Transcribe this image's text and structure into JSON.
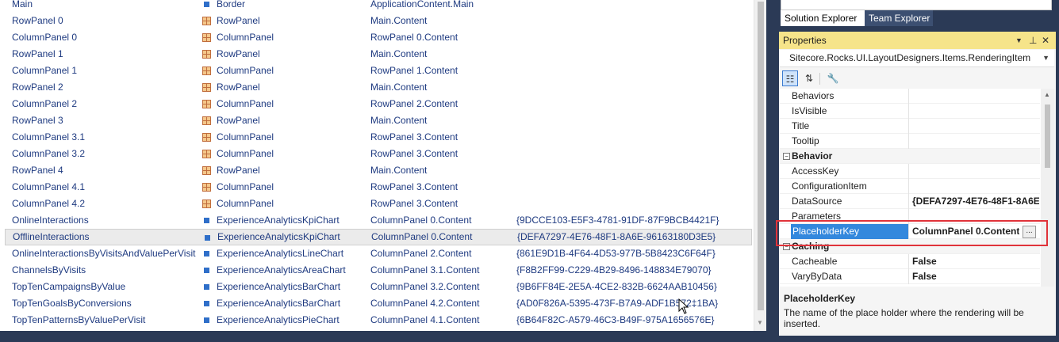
{
  "layout_list": {
    "rows": [
      {
        "name": "Main",
        "icon": "border-icon",
        "type": "Border",
        "placeholder": "ApplicationContent.Main",
        "datasource": ""
      },
      {
        "name": "RowPanel 0",
        "icon": "panel-grid-icon",
        "type": "RowPanel",
        "placeholder": "Main.Content",
        "datasource": ""
      },
      {
        "name": "ColumnPanel 0",
        "icon": "panel-grid-icon",
        "type": "ColumnPanel",
        "placeholder": "RowPanel 0.Content",
        "datasource": ""
      },
      {
        "name": "RowPanel 1",
        "icon": "panel-grid-icon",
        "type": "RowPanel",
        "placeholder": "Main.Content",
        "datasource": ""
      },
      {
        "name": "ColumnPanel 1",
        "icon": "panel-grid-icon",
        "type": "ColumnPanel",
        "placeholder": "RowPanel 1.Content",
        "datasource": ""
      },
      {
        "name": "RowPanel 2",
        "icon": "panel-grid-icon",
        "type": "RowPanel",
        "placeholder": "Main.Content",
        "datasource": ""
      },
      {
        "name": "ColumnPanel 2",
        "icon": "panel-grid-icon",
        "type": "ColumnPanel",
        "placeholder": "RowPanel 2.Content",
        "datasource": ""
      },
      {
        "name": "RowPanel 3",
        "icon": "panel-grid-icon",
        "type": "RowPanel",
        "placeholder": "Main.Content",
        "datasource": ""
      },
      {
        "name": "ColumnPanel 3.1",
        "icon": "panel-grid-icon",
        "type": "ColumnPanel",
        "placeholder": "RowPanel 3.Content",
        "datasource": ""
      },
      {
        "name": "ColumnPanel 3.2",
        "icon": "panel-grid-icon",
        "type": "ColumnPanel",
        "placeholder": "RowPanel 3.Content",
        "datasource": ""
      },
      {
        "name": "RowPanel 4",
        "icon": "panel-grid-icon",
        "type": "RowPanel",
        "placeholder": "Main.Content",
        "datasource": ""
      },
      {
        "name": "ColumnPanel 4.1",
        "icon": "panel-grid-icon",
        "type": "ColumnPanel",
        "placeholder": "RowPanel 3.Content",
        "datasource": ""
      },
      {
        "name": "ColumnPanel 4.2",
        "icon": "panel-grid-icon",
        "type": "ColumnPanel",
        "placeholder": "RowPanel 3.Content",
        "datasource": ""
      },
      {
        "name": "OnlineInteractions",
        "icon": "chart-icon",
        "type": "ExperienceAnalyticsKpiChart",
        "placeholder": "ColumnPanel 0.Content",
        "datasource": "{9DCCE103-E5F3-4781-91DF-87F9BCB4421F}"
      },
      {
        "name": "OfflineInteractions",
        "icon": "chart-icon",
        "type": "ExperienceAnalyticsKpiChart",
        "placeholder": "ColumnPanel 0.Content",
        "datasource": "{DEFA7297-4E76-48F1-8A6E-96163180D3E5}",
        "selected": true
      },
      {
        "name": "OnlineInteractionsByVisitsAndValuePerVisit",
        "icon": "chart-icon",
        "type": "ExperienceAnalyticsLineChart",
        "placeholder": "ColumnPanel 2.Content",
        "datasource": "{861E9D1B-4F64-4D53-977B-5B8423C6F64F}"
      },
      {
        "name": "ChannelsByVisits",
        "icon": "chart-icon",
        "type": "ExperienceAnalyticsAreaChart",
        "placeholder": "ColumnPanel 3.1.Content",
        "datasource": "{F8B2FF99-C229-4B29-8496-148834E79070}"
      },
      {
        "name": "TopTenCampaignsByValue",
        "icon": "chart-icon",
        "type": "ExperienceAnalyticsBarChart",
        "placeholder": "ColumnPanel 3.2.Content",
        "datasource": "{9B6FF84E-2E5A-4CE2-832B-6624AAB10456}"
      },
      {
        "name": "TopTenGoalsByConversions",
        "icon": "chart-icon",
        "type": "ExperienceAnalyticsBarChart",
        "placeholder": "ColumnPanel 4.2.Content",
        "datasource": "{AD0F826A-5395-473F-B7A9-ADF1B572‡1BA}"
      },
      {
        "name": "TopTenPatternsByValuePerVisit",
        "icon": "chart-icon",
        "type": "ExperienceAnalyticsPieChart",
        "placeholder": "ColumnPanel 4.1.Content",
        "datasource": "{6B64F82C-A579-46C3-B49F-975A1656576E}"
      }
    ]
  },
  "tabs": {
    "solution_explorer": "Solution Explorer",
    "team_explorer": "Team Explorer"
  },
  "properties": {
    "title": "Properties",
    "object": "Sitecore.Rocks.UI.LayoutDesigners.Items.RenderingItem",
    "rows": [
      {
        "kind": "prop",
        "name": "Behaviors",
        "value": ""
      },
      {
        "kind": "prop",
        "name": "IsVisible",
        "value": ""
      },
      {
        "kind": "prop",
        "name": "Title",
        "value": ""
      },
      {
        "kind": "prop",
        "name": "Tooltip",
        "value": ""
      },
      {
        "kind": "cat",
        "name": "Behavior",
        "value": ""
      },
      {
        "kind": "prop",
        "name": "AccessKey",
        "value": ""
      },
      {
        "kind": "prop",
        "name": "ConfigurationItem",
        "value": ""
      },
      {
        "kind": "prop",
        "name": "DataSource",
        "value": "{DEFA7297-4E76-48F1-8A6E"
      },
      {
        "kind": "prop",
        "name": "Parameters",
        "value": ""
      },
      {
        "kind": "sel",
        "name": "PlaceholderKey",
        "value": "ColumnPanel 0.Content"
      },
      {
        "kind": "cat",
        "name": "Caching",
        "value": ""
      },
      {
        "kind": "prop",
        "name": "Cacheable",
        "value": "False"
      },
      {
        "kind": "prop",
        "name": "VaryByData",
        "value": "False"
      }
    ],
    "ellipsis": "...",
    "description_title": "PlaceholderKey",
    "description_text": "The name of the place holder where the rendering will be inserted."
  },
  "colors": {
    "accent": "#f6e48a",
    "selection": "#3388dd",
    "highlight_box": "#e0333a",
    "link_text": "#1e3a80",
    "chrome": "#2b3a56"
  }
}
